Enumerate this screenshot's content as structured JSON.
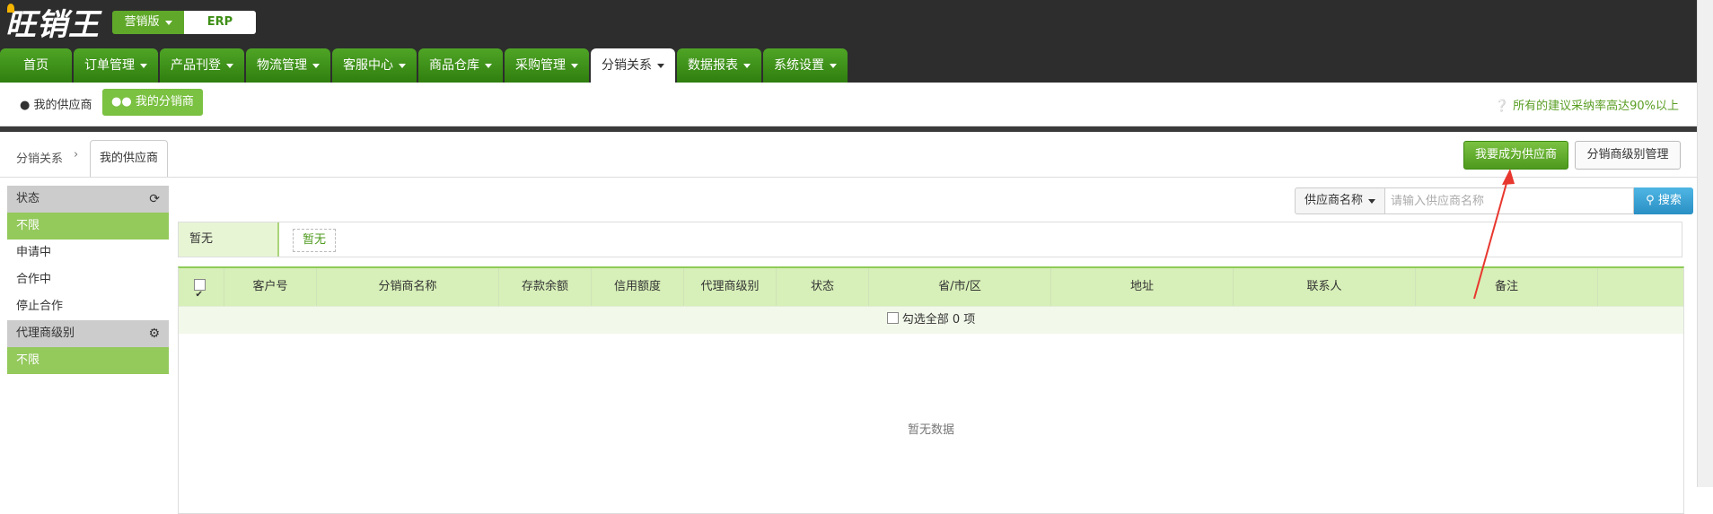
{
  "brand": {
    "logo_text": "旺销王",
    "edition": "营销版",
    "erp": "ERP"
  },
  "nav": [
    {
      "label": "首页",
      "caret": false,
      "active": false
    },
    {
      "label": "订单管理",
      "caret": true,
      "active": false
    },
    {
      "label": "产品刊登",
      "caret": true,
      "active": false
    },
    {
      "label": "物流管理",
      "caret": true,
      "active": false
    },
    {
      "label": "客服中心",
      "caret": true,
      "active": false
    },
    {
      "label": "商品仓库",
      "caret": true,
      "active": false
    },
    {
      "label": "采购管理",
      "caret": true,
      "active": false
    },
    {
      "label": "分销关系",
      "caret": true,
      "active": true
    },
    {
      "label": "数据报表",
      "caret": true,
      "active": false
    },
    {
      "label": "系统设置",
      "caret": true,
      "active": false
    }
  ],
  "subnav": {
    "supplier": "我的供应商",
    "distributor": "我的分销商",
    "tip": "所有的建议采纳率高达90%以上"
  },
  "breadcrumb": {
    "root": "分销关系",
    "current": "我的供应商"
  },
  "actions": {
    "become_supplier": "我要成为供应商",
    "level_manage": "分销商级别管理"
  },
  "sidebar": {
    "status_title": "状态",
    "status_items": [
      {
        "label": "不限",
        "active": true
      },
      {
        "label": "申请中",
        "active": false
      },
      {
        "label": "合作中",
        "active": false
      },
      {
        "label": "停止合作",
        "active": false
      }
    ],
    "level_title": "代理商级别",
    "level_items": [
      {
        "label": "不限",
        "active": true
      }
    ]
  },
  "search": {
    "dropdown": "供应商名称",
    "placeholder": "请输入供应商名称",
    "button": "搜索"
  },
  "filter": {
    "label": "暂无",
    "tag": "暂无"
  },
  "table": {
    "columns": [
      "客户号",
      "分销商名称",
      "存款余额",
      "信用额度",
      "代理商级别",
      "状态",
      "省/市/区",
      "地址",
      "联系人",
      "备注"
    ],
    "select_all": "勾选全部 0 项",
    "empty": "暂无数据"
  },
  "colors": {
    "green": "#4fa526",
    "accent": "#7bc142",
    "blue": "#2a8fc4",
    "arrow": "#e8372e"
  }
}
